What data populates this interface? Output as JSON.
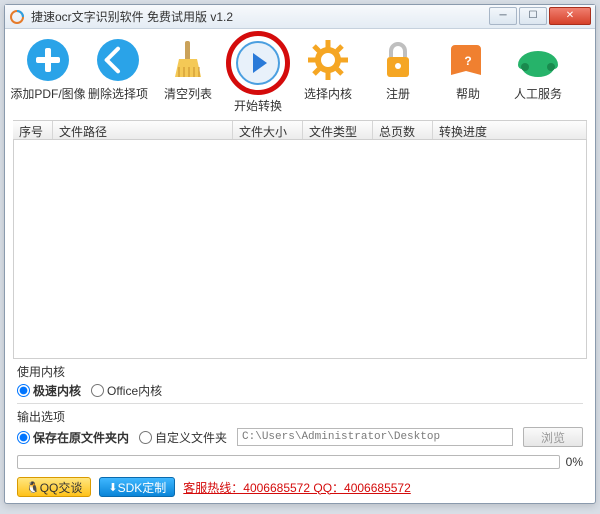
{
  "window": {
    "title": "捷速ocr文字识别软件 免费试用版 v1.2"
  },
  "toolbar": [
    {
      "label": "添加PDF/图像"
    },
    {
      "label": "删除选择项"
    },
    {
      "label": "清空列表"
    },
    {
      "label": "开始转换"
    },
    {
      "label": "选择内核"
    },
    {
      "label": "注册"
    },
    {
      "label": "帮助"
    },
    {
      "label": "人工服务"
    }
  ],
  "columns": {
    "seq": "序号",
    "path": "文件路径",
    "size": "文件大小",
    "type": "文件类型",
    "pages": "总页数",
    "progress": "转换进度"
  },
  "kernel": {
    "title": "使用内核",
    "opt1": "极速内核",
    "opt2": "Office内核"
  },
  "output": {
    "title": "输出选项",
    "opt1": "保存在原文件夹内",
    "opt2": "自定义文件夹",
    "path": "C:\\Users\\Administrator\\Desktop",
    "browse": "浏览"
  },
  "progress": {
    "pct": "0%"
  },
  "footer": {
    "qq": "QQ交谈",
    "sdk": "SDK定制",
    "hotline": "客服热线：4006685572 QQ：4006685572"
  }
}
